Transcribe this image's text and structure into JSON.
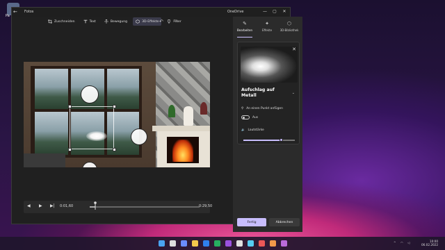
{
  "desktop": {
    "icon_label": "Pa"
  },
  "window": {
    "app_name": "Fotos",
    "account": "OneDrive",
    "controls": {
      "minimize": "—",
      "maximize": "▢",
      "close": "✕"
    }
  },
  "toolbar": {
    "items": [
      {
        "label": "Zuschneiden",
        "icon": "crop-icon"
      },
      {
        "label": "Text",
        "icon": "text-icon"
      },
      {
        "label": "Bewegung",
        "icon": "motion-icon"
      },
      {
        "label": "3D-Effekte",
        "icon": "3d-effects-icon",
        "active": true
      },
      {
        "label": "Filter",
        "icon": "filter-icon"
      }
    ],
    "undo": "↶",
    "redo": "↷"
  },
  "timeline": {
    "current_time": "0:01,60",
    "end_time": "0:29,50",
    "progress": 0.05
  },
  "panel": {
    "tabs": [
      {
        "label": "Bearbeiten",
        "icon": "pencil-icon",
        "selected": true
      },
      {
        "label": "Effekte",
        "icon": "effects-icon"
      },
      {
        "label": "3D-Bibliothek",
        "icon": "3d-library-icon"
      }
    ],
    "effect": {
      "title": "Aufschlag auf Metall",
      "anchor_label": "An einen Punkt anfügen",
      "toggle_label": "Aus",
      "volume_label": "Lautstärke",
      "volume_level": 0.73
    },
    "done_label": "Fertig",
    "cancel_label": "Abbrechen"
  },
  "taskbar": {
    "time": "10:00",
    "date": "06.02.2022",
    "tray_arrow": "^"
  },
  "colors": {
    "accent": "#c8bdfc",
    "window_bg": "#202020",
    "panel_bg": "#2b2b2b"
  }
}
